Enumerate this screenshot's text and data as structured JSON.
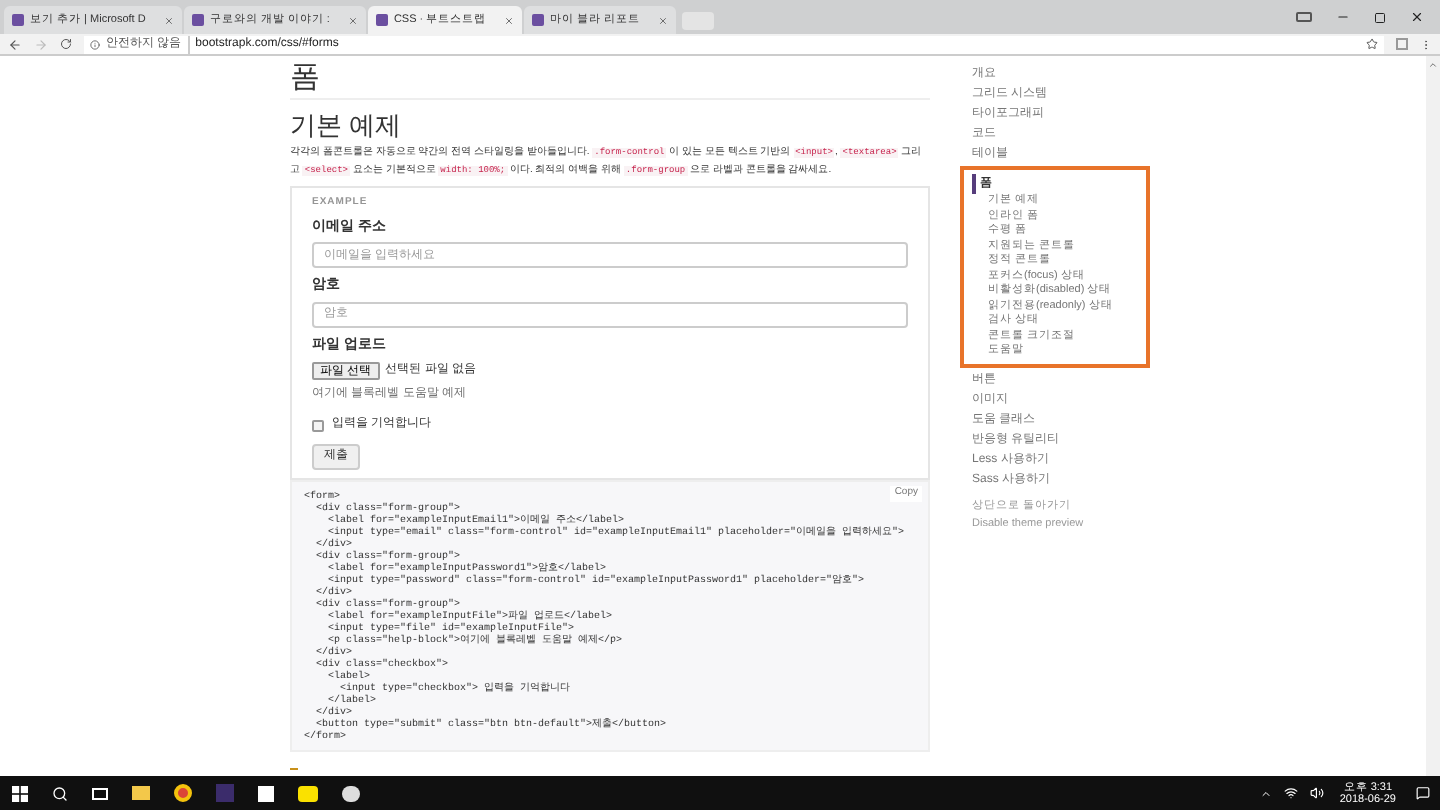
{
  "browser": {
    "tabs": [
      {
        "title": "보기 추가 | Microsoft D",
        "selected": false
      },
      {
        "title": "구로와의 개발 이야기 :",
        "selected": false
      },
      {
        "title": "CSS · 부트스트랩",
        "selected": true
      },
      {
        "title": "마이 블라 리포트",
        "selected": false
      }
    ],
    "address": {
      "security": "안전하지 않음",
      "url": "bootstrapk.com/css/#forms"
    }
  },
  "page": {
    "title": "폼",
    "section_title": "기본 예제",
    "description": [
      {
        "kind": "text",
        "text": "각각의 폼콘트롤은 자동으로 약간의 전역 스타일링을 받아들입니다. "
      },
      {
        "kind": "code",
        "text": ".form-control"
      },
      {
        "kind": "text",
        "text": " 이 있는 모든 텍스트 기반의 "
      },
      {
        "kind": "code",
        "text": "<input>"
      },
      {
        "kind": "text",
        "text": ", "
      },
      {
        "kind": "code",
        "text": "<textarea>"
      },
      {
        "kind": "text",
        "text": " 그리고 "
      },
      {
        "kind": "code",
        "text": "<select>"
      },
      {
        "kind": "text",
        "text": " 요소는 기본적으로 "
      },
      {
        "kind": "code",
        "text": "width: 100%;"
      },
      {
        "kind": "text",
        "text": " 이다. 최적의 여백을 위해 "
      },
      {
        "kind": "code",
        "text": ".form-group"
      },
      {
        "kind": "text",
        "text": " 으로 라벨과 콘트롤을 감싸세요."
      }
    ],
    "example": {
      "label": "EXAMPLE",
      "fields": [
        {
          "kind": "text",
          "label": "이메일 주소",
          "placeholder": "이메일을 입력하세요"
        },
        {
          "kind": "text",
          "label": "암호",
          "placeholder": "암호"
        },
        {
          "kind": "file",
          "label": "파일 업로드",
          "button": "파일 선택",
          "status": "선택된 파일 없음",
          "help": "여기에 블록레벨 도움말 예제"
        },
        {
          "kind": "checkbox",
          "label": "입력을 기억합니다",
          "checked": false
        }
      ],
      "submit": "제출"
    },
    "code": {
      "copy": "Copy",
      "lines": [
        "<form>",
        "  <div class=\"form-group\">",
        "    <label for=\"exampleInputEmail1\">이메일 주소</label>",
        "    <input type=\"email\" class=\"form-control\" id=\"exampleInputEmail1\" placeholder=\"이메일을 입력하세요\">",
        "  </div>",
        "  <div class=\"form-group\">",
        "    <label for=\"exampleInputPassword1\">암호</label>",
        "    <input type=\"password\" class=\"form-control\" id=\"exampleInputPassword1\" placeholder=\"암호\">",
        "  </div>",
        "  <div class=\"form-group\">",
        "    <label for=\"exampleInputFile\">파일 업로드</label>",
        "    <input type=\"file\" id=\"exampleInputFile\">",
        "    <p class=\"help-block\">여기에 블록레벨 도움말 예제</p>",
        "  </div>",
        "  <div class=\"checkbox\">",
        "    <label>",
        "      <input type=\"checkbox\"> 입력을 기억합니다",
        "    </label>",
        "  </div>",
        "  <button type=\"submit\" class=\"btn btn-default\">제출</button>",
        "</form>"
      ]
    }
  },
  "sidebar": {
    "items": [
      {
        "label": "개요",
        "selected": false
      },
      {
        "label": "그리드 시스템",
        "selected": false
      },
      {
        "label": "타이포그래피",
        "selected": false
      },
      {
        "label": "코드",
        "selected": false
      },
      {
        "label": "테이블",
        "selected": false
      },
      {
        "label": "폼",
        "selected": true,
        "children": [
          "기본 예제",
          "인라인 폼",
          "수평 폼",
          "지원되는 콘트롤",
          "정적 콘트롤",
          "포커스(focus) 상태",
          "비활성화(disabled) 상태",
          "읽기전용(readonly) 상태",
          "검사 상태",
          "콘트롤 크기조절",
          "도움말"
        ]
      },
      {
        "label": "버튼",
        "selected": false
      },
      {
        "label": "이미지",
        "selected": false
      },
      {
        "label": "도움 클래스",
        "selected": false
      },
      {
        "label": "반응형 유틸리티",
        "selected": false
      },
      {
        "label": "Less 사용하기",
        "selected": false
      },
      {
        "label": "Sass 사용하기",
        "selected": false
      }
    ],
    "links": [
      "상단으로 돌아가기",
      "Disable theme preview"
    ]
  },
  "taskbar": {
    "time": "오후 3:31",
    "date": "2018-06-29"
  }
}
